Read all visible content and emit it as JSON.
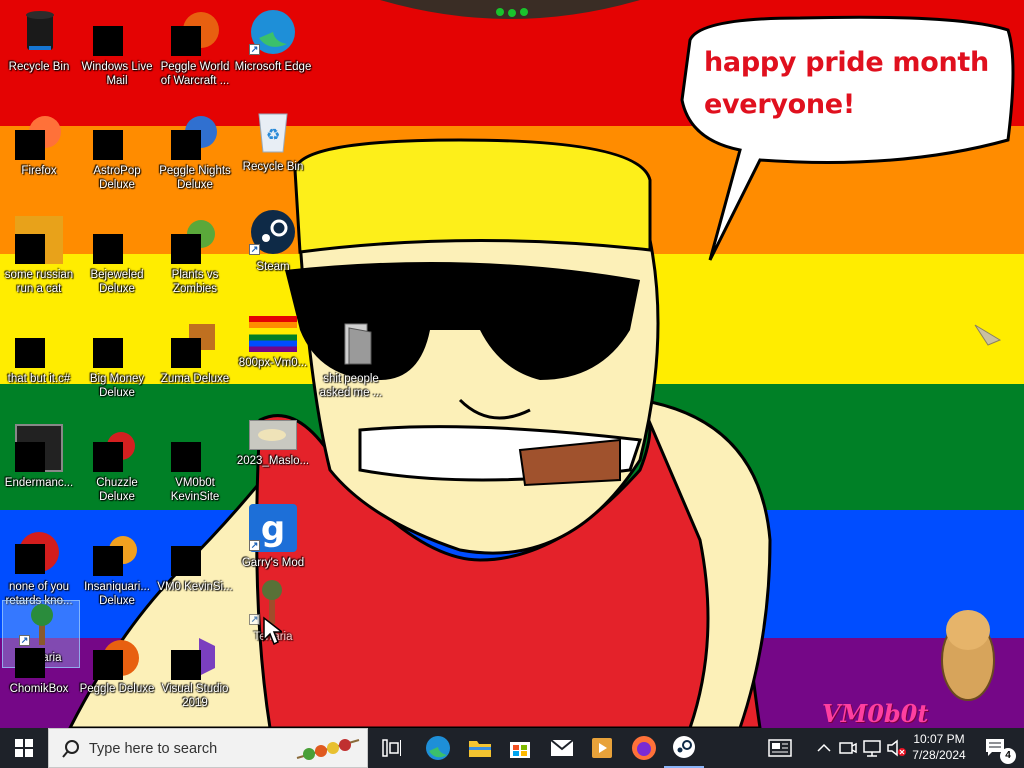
{
  "wallpaper": {
    "stripe_colors": [
      "#e40303",
      "#ff8c00",
      "#ffed00",
      "#008026",
      "#004dff",
      "#750787"
    ],
    "speech_bubble_line1": "happy pride month",
    "speech_bubble_line2": "everyone!",
    "signature": "VM0b0t"
  },
  "desktop_icons": [
    {
      "label": "Recycle Bin"
    },
    {
      "label": "Windows Live Mail"
    },
    {
      "label": "Peggle World of Warcraft ..."
    },
    {
      "label": "Microsoft Edge"
    },
    {
      "label": "Firefox"
    },
    {
      "label": "AstroPop Deluxe"
    },
    {
      "label": "Peggle Nights Deluxe"
    },
    {
      "label": "Recycle Bin"
    },
    {
      "label": "some russian run a cat"
    },
    {
      "label": "Bejeweled Deluxe"
    },
    {
      "label": "Plants vs Zombies"
    },
    {
      "label": "Steam"
    },
    {
      "label": "that but it.c#"
    },
    {
      "label": "Big Money Deluxe"
    },
    {
      "label": "Zuma Deluxe"
    },
    {
      "label": "800px-Vm0..."
    },
    {
      "label": "shit people asked me ..."
    },
    {
      "label": "Endermanc..."
    },
    {
      "label": "Chuzzle Deluxe"
    },
    {
      "label": "VM0b0t KevinSite"
    },
    {
      "label": "2023_Maslo..."
    },
    {
      "label": "none of you retards kno..."
    },
    {
      "label": "Insaniquari... Deluxe"
    },
    {
      "label": "VM0 KevinSi..."
    },
    {
      "label": "Garry's Mod"
    },
    {
      "label": "Terraria"
    },
    {
      "label": "Terraria"
    },
    {
      "label": "ChomikBox"
    },
    {
      "label": "Peggle Deluxe"
    },
    {
      "label": "Visual Studio 2019"
    }
  ],
  "taskbar": {
    "search_placeholder": "Type here to search",
    "time": "10:07 PM",
    "date": "7/28/2024",
    "notification_count": "4",
    "pinned": [
      "task-view",
      "edge",
      "file-explorer",
      "microsoft-store",
      "mail",
      "movies",
      "firefox",
      "steam"
    ]
  }
}
